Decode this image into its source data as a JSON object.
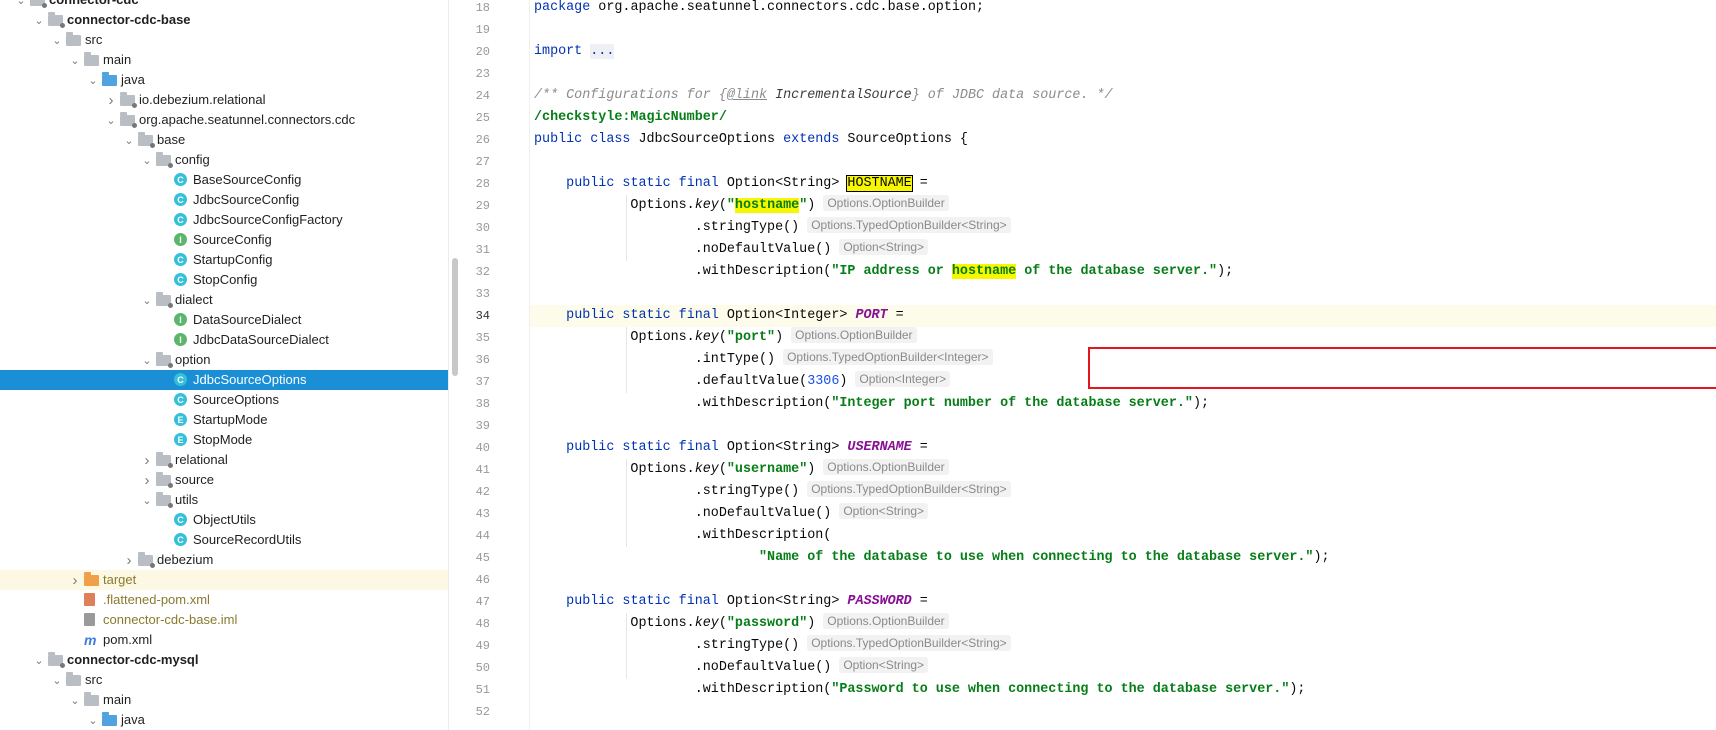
{
  "tree": {
    "items": [
      {
        "label": "connector-cdc",
        "depth": 0,
        "arrow": "open",
        "icon": "module-folder-icon",
        "bold": true
      },
      {
        "label": "connector-cdc-base",
        "depth": 1,
        "arrow": "open",
        "icon": "module-folder-icon",
        "bold": true
      },
      {
        "label": "src",
        "depth": 2,
        "arrow": "open",
        "icon": "folder-icon"
      },
      {
        "label": "main",
        "depth": 3,
        "arrow": "open",
        "icon": "folder-icon"
      },
      {
        "label": "java",
        "depth": 4,
        "arrow": "open",
        "icon": "source-folder-icon"
      },
      {
        "label": "io.debezium.relational",
        "depth": 5,
        "arrow": "closed",
        "icon": "package-icon"
      },
      {
        "label": "org.apache.seatunnel.connectors.cdc",
        "depth": 5,
        "arrow": "open",
        "icon": "package-icon"
      },
      {
        "label": "base",
        "depth": 6,
        "arrow": "open",
        "icon": "package-icon"
      },
      {
        "label": "config",
        "depth": 7,
        "arrow": "open",
        "icon": "package-icon"
      },
      {
        "label": "BaseSourceConfig",
        "depth": 8,
        "icon": "class-icon"
      },
      {
        "label": "JdbcSourceConfig",
        "depth": 8,
        "icon": "class-icon"
      },
      {
        "label": "JdbcSourceConfigFactory",
        "depth": 8,
        "icon": "class-icon"
      },
      {
        "label": "SourceConfig",
        "depth": 8,
        "icon": "interface-icon"
      },
      {
        "label": "StartupConfig",
        "depth": 8,
        "icon": "class-icon"
      },
      {
        "label": "StopConfig",
        "depth": 8,
        "icon": "class-icon"
      },
      {
        "label": "dialect",
        "depth": 7,
        "arrow": "open",
        "icon": "package-icon"
      },
      {
        "label": "DataSourceDialect",
        "depth": 8,
        "icon": "interface-icon"
      },
      {
        "label": "JdbcDataSourceDialect",
        "depth": 8,
        "icon": "interface-icon"
      },
      {
        "label": "option",
        "depth": 7,
        "arrow": "open",
        "icon": "package-icon"
      },
      {
        "label": "JdbcSourceOptions",
        "depth": 8,
        "icon": "class-icon",
        "selected": true
      },
      {
        "label": "SourceOptions",
        "depth": 8,
        "icon": "class-icon"
      },
      {
        "label": "StartupMode",
        "depth": 8,
        "icon": "enum-icon"
      },
      {
        "label": "StopMode",
        "depth": 8,
        "icon": "enum-icon"
      },
      {
        "label": "relational",
        "depth": 7,
        "arrow": "closed",
        "icon": "package-icon"
      },
      {
        "label": "source",
        "depth": 7,
        "arrow": "closed",
        "icon": "package-icon"
      },
      {
        "label": "utils",
        "depth": 7,
        "arrow": "open",
        "icon": "package-icon"
      },
      {
        "label": "ObjectUtils",
        "depth": 8,
        "icon": "class-icon"
      },
      {
        "label": "SourceRecordUtils",
        "depth": 8,
        "icon": "class-icon"
      },
      {
        "label": "debezium",
        "depth": 6,
        "arrow": "closed",
        "icon": "package-icon"
      },
      {
        "label": "target",
        "depth": 3,
        "arrow": "closed",
        "icon": "excluded-folder-icon",
        "excluded": true
      },
      {
        "label": ".flattened-pom.xml",
        "depth": 3,
        "icon": "xml-file-icon",
        "olive": true
      },
      {
        "label": "connector-cdc-base.iml",
        "depth": 3,
        "icon": "iml-file-icon",
        "olive": true
      },
      {
        "label": "pom.xml",
        "depth": 3,
        "icon": "maven-icon"
      },
      {
        "label": "connector-cdc-mysql",
        "depth": 1,
        "arrow": "open",
        "icon": "module-folder-icon",
        "bold": true
      },
      {
        "label": "src",
        "depth": 2,
        "arrow": "open",
        "icon": "folder-icon"
      },
      {
        "label": "main",
        "depth": 3,
        "arrow": "open",
        "icon": "folder-icon"
      },
      {
        "label": "java",
        "depth": 4,
        "arrow": "open",
        "icon": "source-folder-icon"
      }
    ]
  },
  "editor": {
    "current_line": "34",
    "lines": [
      {
        "n": "18",
        "parts": [
          [
            "kw",
            "package "
          ],
          [
            "",
            "org.apache.seatunnel.connectors.cdc.base.option;"
          ]
        ]
      },
      {
        "n": "19",
        "parts": []
      },
      {
        "n": "20",
        "parts": [
          [
            "kw",
            "import "
          ],
          [
            "fold",
            "..."
          ]
        ]
      },
      {
        "n": "23",
        "parts": []
      },
      {
        "n": "24",
        "parts": [
          [
            "cmt",
            "/** Configurations for {"
          ],
          [
            "cmttag",
            "@link"
          ],
          [
            "cmtref",
            " IncrementalSource"
          ],
          [
            "cmt",
            "} of JDBC data source. */"
          ]
        ]
      },
      {
        "n": "25",
        "parts": [
          [
            "str",
            "/checkstyle:MagicNumber/"
          ]
        ]
      },
      {
        "n": "26",
        "parts": [
          [
            "kw",
            "public class "
          ],
          [
            "",
            "JdbcSourceOptions "
          ],
          [
            "kw",
            "extends "
          ],
          [
            "",
            "SourceOptions {"
          ]
        ]
      },
      {
        "n": "27",
        "parts": []
      },
      {
        "n": "28",
        "parts": [
          [
            "",
            "    "
          ],
          [
            "kw",
            "public static final "
          ],
          [
            "",
            "Option<String> "
          ],
          [
            "hlbox",
            "HOSTNAME"
          ],
          [
            "",
            " ="
          ]
        ]
      },
      {
        "n": "29",
        "parts": [
          [
            "",
            "            Options."
          ],
          [
            "ital",
            "key"
          ],
          [
            "",
            "("
          ],
          [
            "str",
            "\""
          ],
          [
            "strhl",
            "hostname"
          ],
          [
            "str",
            "\""
          ],
          [
            "",
            ")"
          ],
          [
            "hint",
            "Options.OptionBuilder"
          ]
        ]
      },
      {
        "n": "30",
        "parts": [
          [
            "",
            "                    .stringType()"
          ],
          [
            "hint",
            "Options.TypedOptionBuilder<String>"
          ]
        ]
      },
      {
        "n": "31",
        "parts": [
          [
            "",
            "                    .noDefaultValue()"
          ],
          [
            "hint",
            "Option<String>"
          ]
        ]
      },
      {
        "n": "32",
        "parts": [
          [
            "",
            "                    .withDescription("
          ],
          [
            "str",
            "\"IP address or "
          ],
          [
            "strhl",
            "hostname"
          ],
          [
            "str",
            " of the database server.\""
          ],
          [
            "",
            ");"
          ]
        ]
      },
      {
        "n": "33",
        "parts": []
      },
      {
        "n": "34",
        "parts": [
          [
            "",
            "    "
          ],
          [
            "kw",
            "public static final "
          ],
          [
            "",
            "Option<Integer> "
          ],
          [
            "const",
            "PORT"
          ],
          [
            "",
            " ="
          ]
        ]
      },
      {
        "n": "35",
        "parts": [
          [
            "",
            "            Options."
          ],
          [
            "ital",
            "key"
          ],
          [
            "",
            "("
          ],
          [
            "str",
            "\"port\""
          ],
          [
            "",
            ")"
          ],
          [
            "hint",
            "Options.OptionBuilder"
          ]
        ]
      },
      {
        "n": "36",
        "parts": [
          [
            "",
            "                    .intType()"
          ],
          [
            "hint",
            "Options.TypedOptionBuilder<Integer>"
          ]
        ]
      },
      {
        "n": "37",
        "parts": [
          [
            "",
            "                    .defaultValue("
          ],
          [
            "num",
            "3306"
          ],
          [
            "",
            ")"
          ],
          [
            "hint",
            "Option<Integer>"
          ]
        ]
      },
      {
        "n": "38",
        "parts": [
          [
            "",
            "                    .withDescription("
          ],
          [
            "str",
            "\"Integer port number of the database server.\""
          ],
          [
            "",
            ");"
          ]
        ]
      },
      {
        "n": "39",
        "parts": []
      },
      {
        "n": "40",
        "parts": [
          [
            "",
            "    "
          ],
          [
            "kw",
            "public static final "
          ],
          [
            "",
            "Option<String> "
          ],
          [
            "const",
            "USERNAME"
          ],
          [
            "",
            " ="
          ]
        ]
      },
      {
        "n": "41",
        "parts": [
          [
            "",
            "            Options."
          ],
          [
            "ital",
            "key"
          ],
          [
            "",
            "("
          ],
          [
            "str",
            "\"username\""
          ],
          [
            "",
            ")"
          ],
          [
            "hint",
            "Options.OptionBuilder"
          ]
        ]
      },
      {
        "n": "42",
        "parts": [
          [
            "",
            "                    .stringType()"
          ],
          [
            "hint",
            "Options.TypedOptionBuilder<String>"
          ]
        ]
      },
      {
        "n": "43",
        "parts": [
          [
            "",
            "                    .noDefaultValue()"
          ],
          [
            "hint",
            "Option<String>"
          ]
        ]
      },
      {
        "n": "44",
        "parts": [
          [
            "",
            "                    .withDescription("
          ]
        ]
      },
      {
        "n": "45",
        "parts": [
          [
            "",
            "                            "
          ],
          [
            "str",
            "\"Name of the database to use when connecting to the database server.\""
          ],
          [
            "",
            ");"
          ]
        ]
      },
      {
        "n": "46",
        "parts": []
      },
      {
        "n": "47",
        "parts": [
          [
            "",
            "    "
          ],
          [
            "kw",
            "public static final "
          ],
          [
            "",
            "Option<String> "
          ],
          [
            "const",
            "PASSWORD"
          ],
          [
            "",
            " ="
          ]
        ]
      },
      {
        "n": "48",
        "parts": [
          [
            "",
            "            Options."
          ],
          [
            "ital",
            "key"
          ],
          [
            "",
            "("
          ],
          [
            "str",
            "\"password\""
          ],
          [
            "",
            ")"
          ],
          [
            "hint",
            "Options.OptionBuilder"
          ]
        ]
      },
      {
        "n": "49",
        "parts": [
          [
            "",
            "                    .stringType()"
          ],
          [
            "hint",
            "Options.TypedOptionBuilder<String>"
          ]
        ]
      },
      {
        "n": "50",
        "parts": [
          [
            "",
            "                    .noDefaultValue()"
          ],
          [
            "hint",
            "Option<String>"
          ]
        ]
      },
      {
        "n": "51",
        "parts": [
          [
            "",
            "                    .withDescription("
          ],
          [
            "str",
            "\"Password to use when connecting to the database server.\""
          ],
          [
            "",
            ");"
          ]
        ]
      },
      {
        "n": "52",
        "parts": []
      }
    ]
  }
}
